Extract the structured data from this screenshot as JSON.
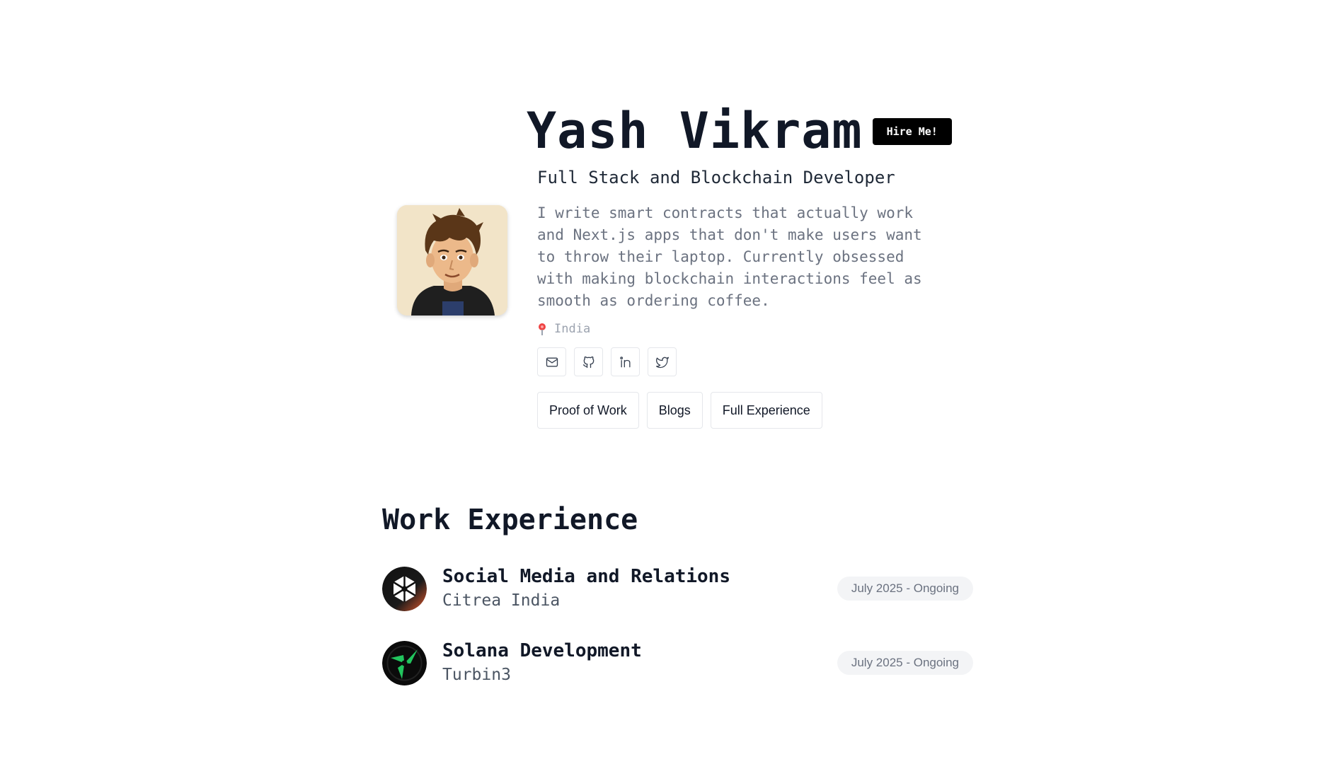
{
  "header": {
    "name": "Yash Vikram",
    "hire_label": "Hire Me!"
  },
  "intro": {
    "role": "Full Stack and Blockchain Developer",
    "bio": "I write smart contracts that actually work and Next.js apps that don't make users want to throw their laptop. Currently obsessed with making blockchain interactions feel as smooth as ordering coffee.",
    "location": "India"
  },
  "socials": [
    {
      "icon": "mail-icon"
    },
    {
      "icon": "github-icon"
    },
    {
      "icon": "linkedin-icon"
    },
    {
      "icon": "twitter-icon"
    }
  ],
  "nav_buttons": [
    {
      "label": "Proof of Work"
    },
    {
      "label": "Blogs"
    },
    {
      "label": "Full Experience"
    }
  ],
  "work": {
    "title": "Work Experience",
    "jobs": [
      {
        "role": "Social Media and Relations",
        "company": "Citrea India",
        "period": "July 2025 - Ongoing",
        "logo": "citrea-logo"
      },
      {
        "role": "Solana Development",
        "company": "Turbin3",
        "period": "July 2025 - Ongoing",
        "logo": "turbin3-logo"
      }
    ]
  },
  "colors": {
    "text": "#111827",
    "muted": "#6b7280",
    "hire_bg": "#000000",
    "badge_bg": "#f3f4f6",
    "turbin3_accent": "#22c55e",
    "citrea_accent": "#e2582c"
  }
}
